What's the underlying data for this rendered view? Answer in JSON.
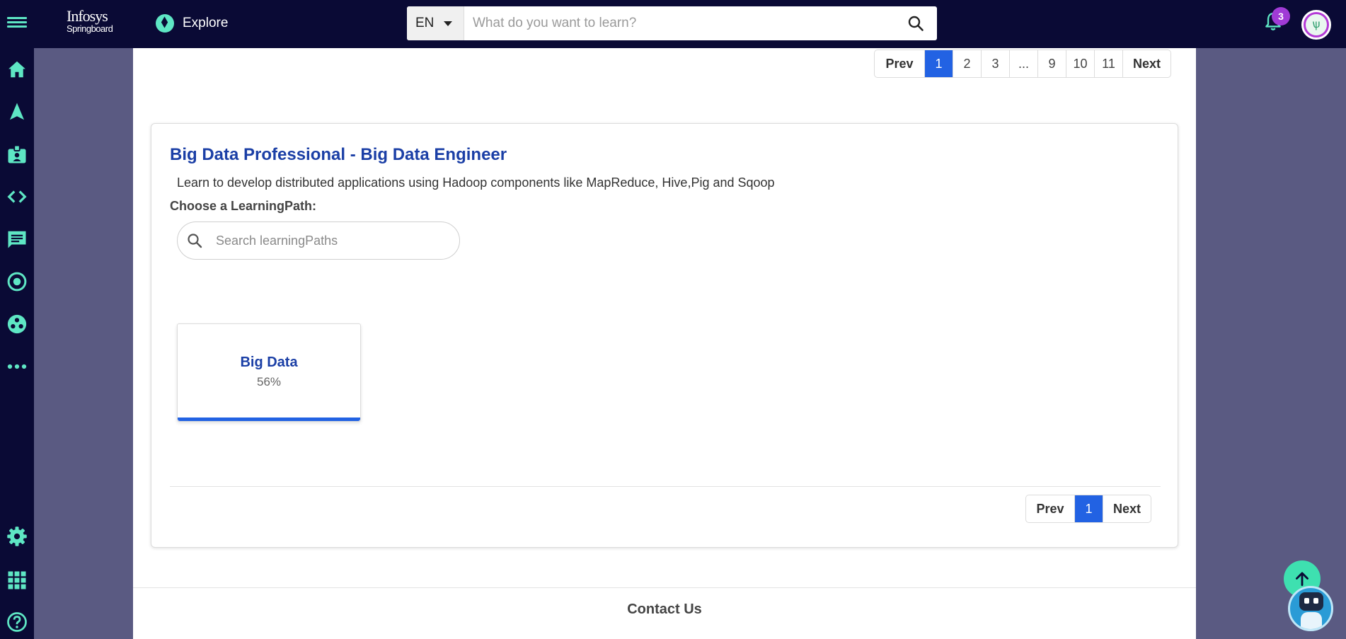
{
  "header": {
    "logo_line1": "Infosys",
    "logo_line2": "Springboard",
    "explore_label": "Explore",
    "language": "EN",
    "search_placeholder": "What do you want to learn?",
    "notification_count": "3"
  },
  "sidebar": {
    "items": [
      "home-icon",
      "navigate-icon",
      "id-card-icon",
      "code-icon",
      "chat-icon",
      "target-icon",
      "community-icon",
      "more-icon",
      "settings-icon",
      "apps-grid-icon",
      "help-icon"
    ]
  },
  "top_pager": {
    "prev": "Prev",
    "pages": [
      "1",
      "2",
      "3",
      "...",
      "9",
      "10",
      "11"
    ],
    "active": "1",
    "next": "Next"
  },
  "card": {
    "title": "Big Data Professional - Big Data Engineer",
    "description": "Learn to develop distributed applications using Hadoop components like MapReduce, Hive,Pig and Sqoop",
    "choose_label": "Choose a LearningPath:",
    "search_placeholder": "Search learningPaths",
    "paths": [
      {
        "name": "Big Data",
        "progress_label": "56%",
        "progress": 0.56
      }
    ],
    "pager": {
      "prev": "Prev",
      "pages": [
        "1"
      ],
      "active": "1",
      "next": "Next"
    }
  },
  "footer": {
    "contact_label": "Contact Us"
  },
  "colors": {
    "topbar_bg": "#0a0a35",
    "accent": "#5ee6c4",
    "title_blue": "#1b3fa6",
    "active_page": "#2262e3",
    "badge": "#a03bd6",
    "band": "#5a5a82"
  }
}
